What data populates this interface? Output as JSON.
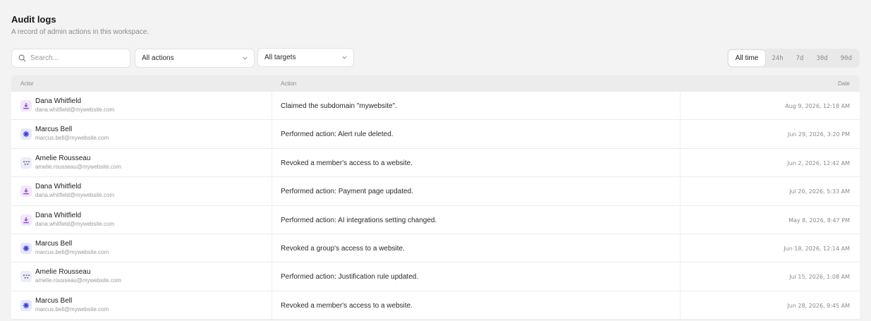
{
  "header": {
    "title": "Audit logs",
    "subtitle": "A record of admin actions in this workspace."
  },
  "filters": {
    "search_placeholder": "Search...",
    "actions_value": "All actions",
    "targets_value": "All targets"
  },
  "range": {
    "options": [
      "All time",
      "24h",
      "7d",
      "30d",
      "90d"
    ],
    "selected": "All time"
  },
  "table": {
    "columns": [
      "Actor",
      "Action",
      "Date"
    ],
    "rows": [
      {
        "name": "Dana Whitfield",
        "email": "dana.whitfield@mywebsite.com",
        "action": "Claimed the subdomain \"mywebsite\".",
        "date": "Aug 9, 2026, 12:18 AM",
        "avatar": "download-icon"
      },
      {
        "name": "Marcus Bell",
        "email": "marcus.bell@mywebsite.com",
        "action": "Performed action: Alert rule deleted.",
        "date": "Jun 29, 2026, 3:20 PM",
        "avatar": "asterisk-icon"
      },
      {
        "name": "Amelie Rousseau",
        "email": "amelie.rousseau@mywebsite.com",
        "action": "Revoked a member's access to a website.",
        "date": "Jun 2, 2026, 12:42 AM",
        "avatar": "dots-icon"
      },
      {
        "name": "Dana Whitfield",
        "email": "dana.whitfield@mywebsite.com",
        "action": "Performed action: Payment page updated.",
        "date": "Jul 20, 2026, 5:33 AM",
        "avatar": "download-icon"
      },
      {
        "name": "Dana Whitfield",
        "email": "dana.whitfield@mywebsite.com",
        "action": "Performed action: AI integrations setting changed.",
        "date": "May 8, 2026, 8:47 PM",
        "avatar": "download-icon"
      },
      {
        "name": "Marcus Bell",
        "email": "marcus.bell@mywebsite.com",
        "action": "Revoked a group's access to a website.",
        "date": "Jun 18, 2026, 12:14 AM",
        "avatar": "asterisk-icon"
      },
      {
        "name": "Amelie Rousseau",
        "email": "amelie.rousseau@mywebsite.com",
        "action": "Performed action: Justification rule updated.",
        "date": "Jul 15, 2026, 1:08 AM",
        "avatar": "dots-icon"
      },
      {
        "name": "Marcus Bell",
        "email": "marcus.bell@mywebsite.com",
        "action": "Revoked a member's access to a website.",
        "date": "Jun 28, 2026, 9:45 AM",
        "avatar": "asterisk-icon"
      }
    ]
  },
  "colors": {
    "dana_avatar": "#8b3fd6",
    "marcus_avatar": "#3a3fd0",
    "amelie_avatar": "#5b5f9a"
  }
}
